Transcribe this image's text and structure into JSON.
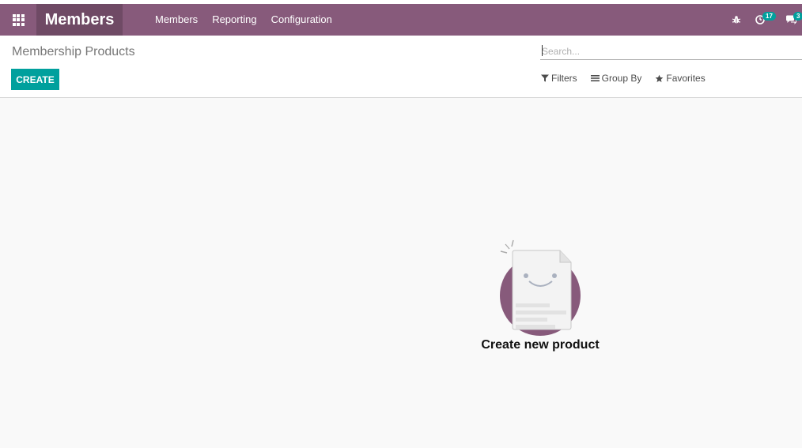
{
  "app": {
    "name": "Members"
  },
  "menu": {
    "items": [
      {
        "label": "Members"
      },
      {
        "label": "Reporting"
      },
      {
        "label": "Configuration"
      }
    ]
  },
  "systray": {
    "activities_count": "17",
    "messages_count": "3"
  },
  "control_panel": {
    "breadcrumb": "Membership Products",
    "create_label": "CREATE",
    "search_placeholder": "Search...",
    "filters_label": "Filters",
    "groupby_label": "Group By",
    "favorites_label": "Favorites"
  },
  "helper": {
    "title": "Create new product"
  },
  "colors": {
    "brand": "#875a7b",
    "brand_dark": "#6f4a65",
    "accent": "#00a09d"
  }
}
